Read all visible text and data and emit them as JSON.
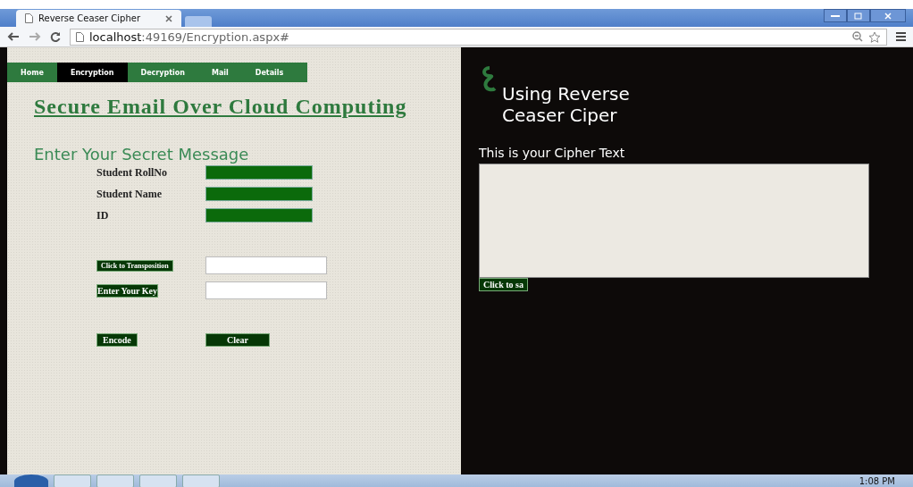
{
  "browser": {
    "tab_title": "Reverse Ceaser Cipher",
    "url_host": "localhost",
    "url_rest": ":49169/Encryption.aspx#"
  },
  "nav": [
    {
      "label": "Home",
      "selected": false
    },
    {
      "label": "Encryption",
      "selected": true
    },
    {
      "label": "Decryption",
      "selected": false
    },
    {
      "label": "Mail",
      "selected": false
    },
    {
      "label": "Details",
      "selected": false
    }
  ],
  "heading": "Secure Email Over Cloud Computing",
  "form_title": "Enter Your Secret Message",
  "fields": [
    {
      "label": "Student RollNo"
    },
    {
      "label": "Student Name"
    },
    {
      "label": "ID"
    }
  ],
  "transposition_button": "Click to Transposition",
  "key_button": "Enter Your Key",
  "encode_button": "Encode",
  "clear_button": "Clear",
  "side_title": "Using Reverse Ceaser Ciper",
  "cipher_label": "This is your Cipher Text",
  "save_button": "Click to sa",
  "taskbar": {
    "clock": "1:08 PM"
  }
}
